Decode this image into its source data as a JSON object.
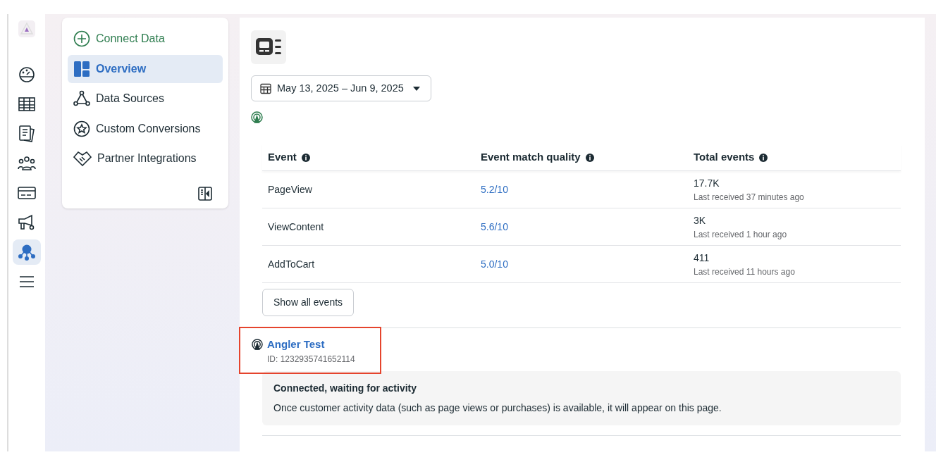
{
  "rail": {
    "items": [
      {
        "selected": false
      },
      {
        "selected": false
      },
      {
        "selected": false
      },
      {
        "selected": false
      },
      {
        "selected": false
      },
      {
        "selected": false
      },
      {
        "selected": true
      },
      {
        "selected": false
      }
    ]
  },
  "nav": {
    "items": [
      {
        "label": "Connect Data",
        "kind": "action",
        "selected": false
      },
      {
        "label": "Overview",
        "kind": "link",
        "selected": true
      },
      {
        "label": "Data Sources",
        "kind": "link",
        "selected": false
      },
      {
        "label": "Custom Conversions",
        "kind": "link",
        "selected": false
      },
      {
        "label": "Partner Integrations",
        "kind": "link",
        "selected": false
      }
    ]
  },
  "date_range": "May 13, 2025 – Jun 9, 2025",
  "events_table": {
    "columns": [
      "Event",
      "Event match quality",
      "Total events"
    ],
    "rows": [
      {
        "event": "PageView",
        "quality": "5.2/10",
        "total": "17.7K",
        "last": "Last received 37 minutes ago"
      },
      {
        "event": "ViewContent",
        "quality": "5.6/10",
        "total": "3K",
        "last": "Last received 1 hour ago"
      },
      {
        "event": "AddToCart",
        "quality": "5.0/10",
        "total": "411",
        "last": "Last received 11 hours ago"
      }
    ],
    "show_all": "Show all events"
  },
  "source": {
    "name": "Angler Test",
    "id": "ID: 1232935741652114",
    "highlighted": true,
    "notice": {
      "title": "Connected, waiting for activity",
      "text": "Once customer activity data (such as page views or purchases) is available, it will appear on this page."
    }
  }
}
